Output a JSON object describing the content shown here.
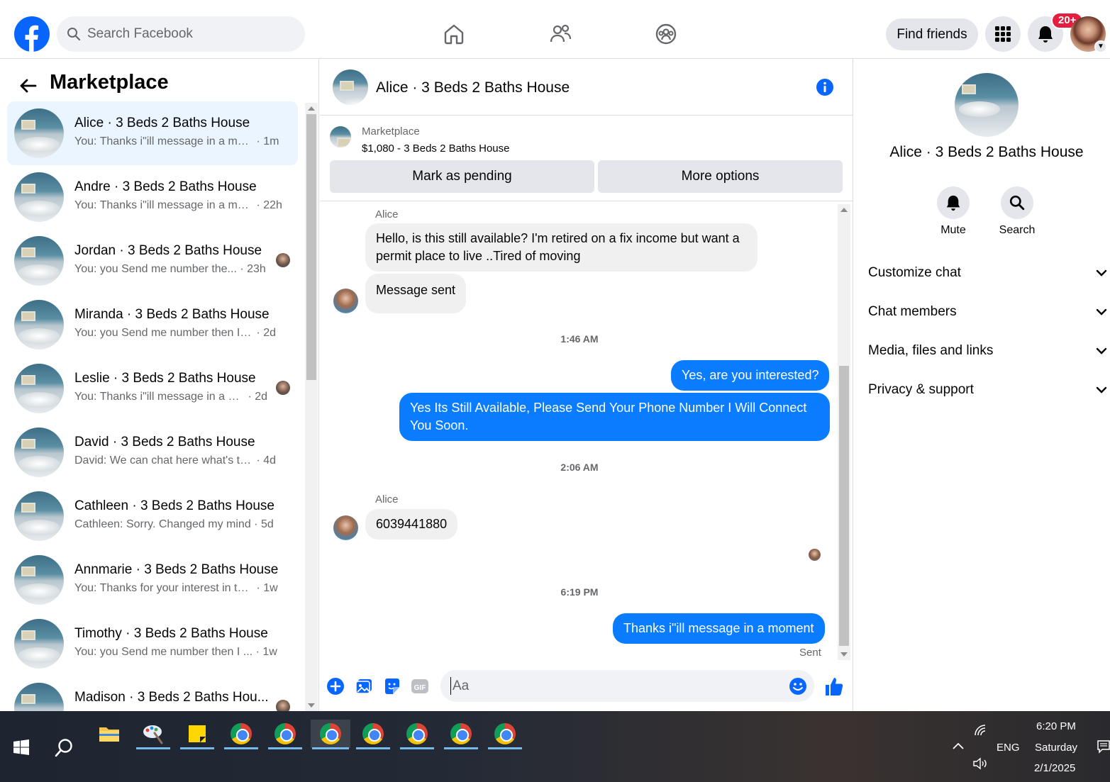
{
  "topbar": {
    "search_placeholder": "Search Facebook",
    "find_friends": "Find friends",
    "notifications_badge": "20+"
  },
  "left": {
    "title": "Marketplace",
    "conversations": [
      {
        "name": "Alice · 3 Beds 2 Baths House",
        "preview": "You: Thanks i\"ill message in a mo...",
        "time": "1m",
        "active": true
      },
      {
        "name": "Andre · 3 Beds 2 Baths House",
        "preview": "You: Thanks i\"ill message in a mo...",
        "time": "22h"
      },
      {
        "name": "Jordan · 3 Beds 2 Baths House",
        "preview": "You: you Send me number the...",
        "time": "23h",
        "seen": true
      },
      {
        "name": "Miranda · 3 Beds 2 Baths House",
        "preview": "You: you Send me number then I w...",
        "time": "2d"
      },
      {
        "name": "Leslie · 3 Beds 2 Baths House",
        "preview": "You: Thanks i\"ill message in a m...",
        "time": "2d",
        "seen": true
      },
      {
        "name": "David · 3 Beds 2 Baths House",
        "preview": "David: We can chat here what's the...",
        "time": "4d"
      },
      {
        "name": "Cathleen · 3 Beds 2 Baths House",
        "preview": "Cathleen: Sorry. Changed my mind",
        "time": "5d"
      },
      {
        "name": "Annmarie · 3 Beds 2 Baths House",
        "preview": "You: Thanks for your interest in the...",
        "time": "1w"
      },
      {
        "name": "Timothy · 3 Beds 2 Baths House",
        "preview": "You: you Send me number then I ...",
        "time": "1w"
      },
      {
        "name": "Madison · 3 Beds 2 Baths Hou...",
        "preview": "",
        "time": "",
        "seen": true
      }
    ]
  },
  "chat": {
    "title": "Alice · 3 Beds 2 Baths House",
    "marketplace_label": "Marketplace",
    "listing": "$1,080 - 3 Beds 2 Baths House",
    "mark_pending": "Mark as pending",
    "more_options": "More options",
    "sender_1": "Alice",
    "msg_1": "Hello, is this still available? I'm retired on a fix income but want a permit place to live ..Tired of moving",
    "msg_2": "Message sent",
    "ts_1": "1:46 AM",
    "msg_3": "Yes, are you interested?",
    "msg_4": "Yes Its Still Available, Please Send Your Phone Number I Will Connect You Soon.",
    "ts_2": "2:06 AM",
    "sender_2": "Alice",
    "msg_5": "6039441880",
    "ts_3": "6:19 PM",
    "msg_6": "Thanks i\"ill message in a moment",
    "sent_status": "Sent",
    "composer_placeholder": "Aa"
  },
  "info": {
    "name": "Alice · 3 Beds 2 Baths House",
    "mute": "Mute",
    "search": "Search",
    "sections": [
      "Customize chat",
      "Chat members",
      "Media, files and links",
      "Privacy & support"
    ]
  },
  "taskbar": {
    "language": "ENG",
    "time": "6:20 PM",
    "day": "Saturday",
    "date": "2/1/2025"
  },
  "colors": {
    "brand": "#0866ff",
    "outgoing_bubble": "#0a7cff",
    "incoming_bubble": "#f0f0f0",
    "active_row": "#ebf5ff",
    "badge": "#e41e3f"
  }
}
